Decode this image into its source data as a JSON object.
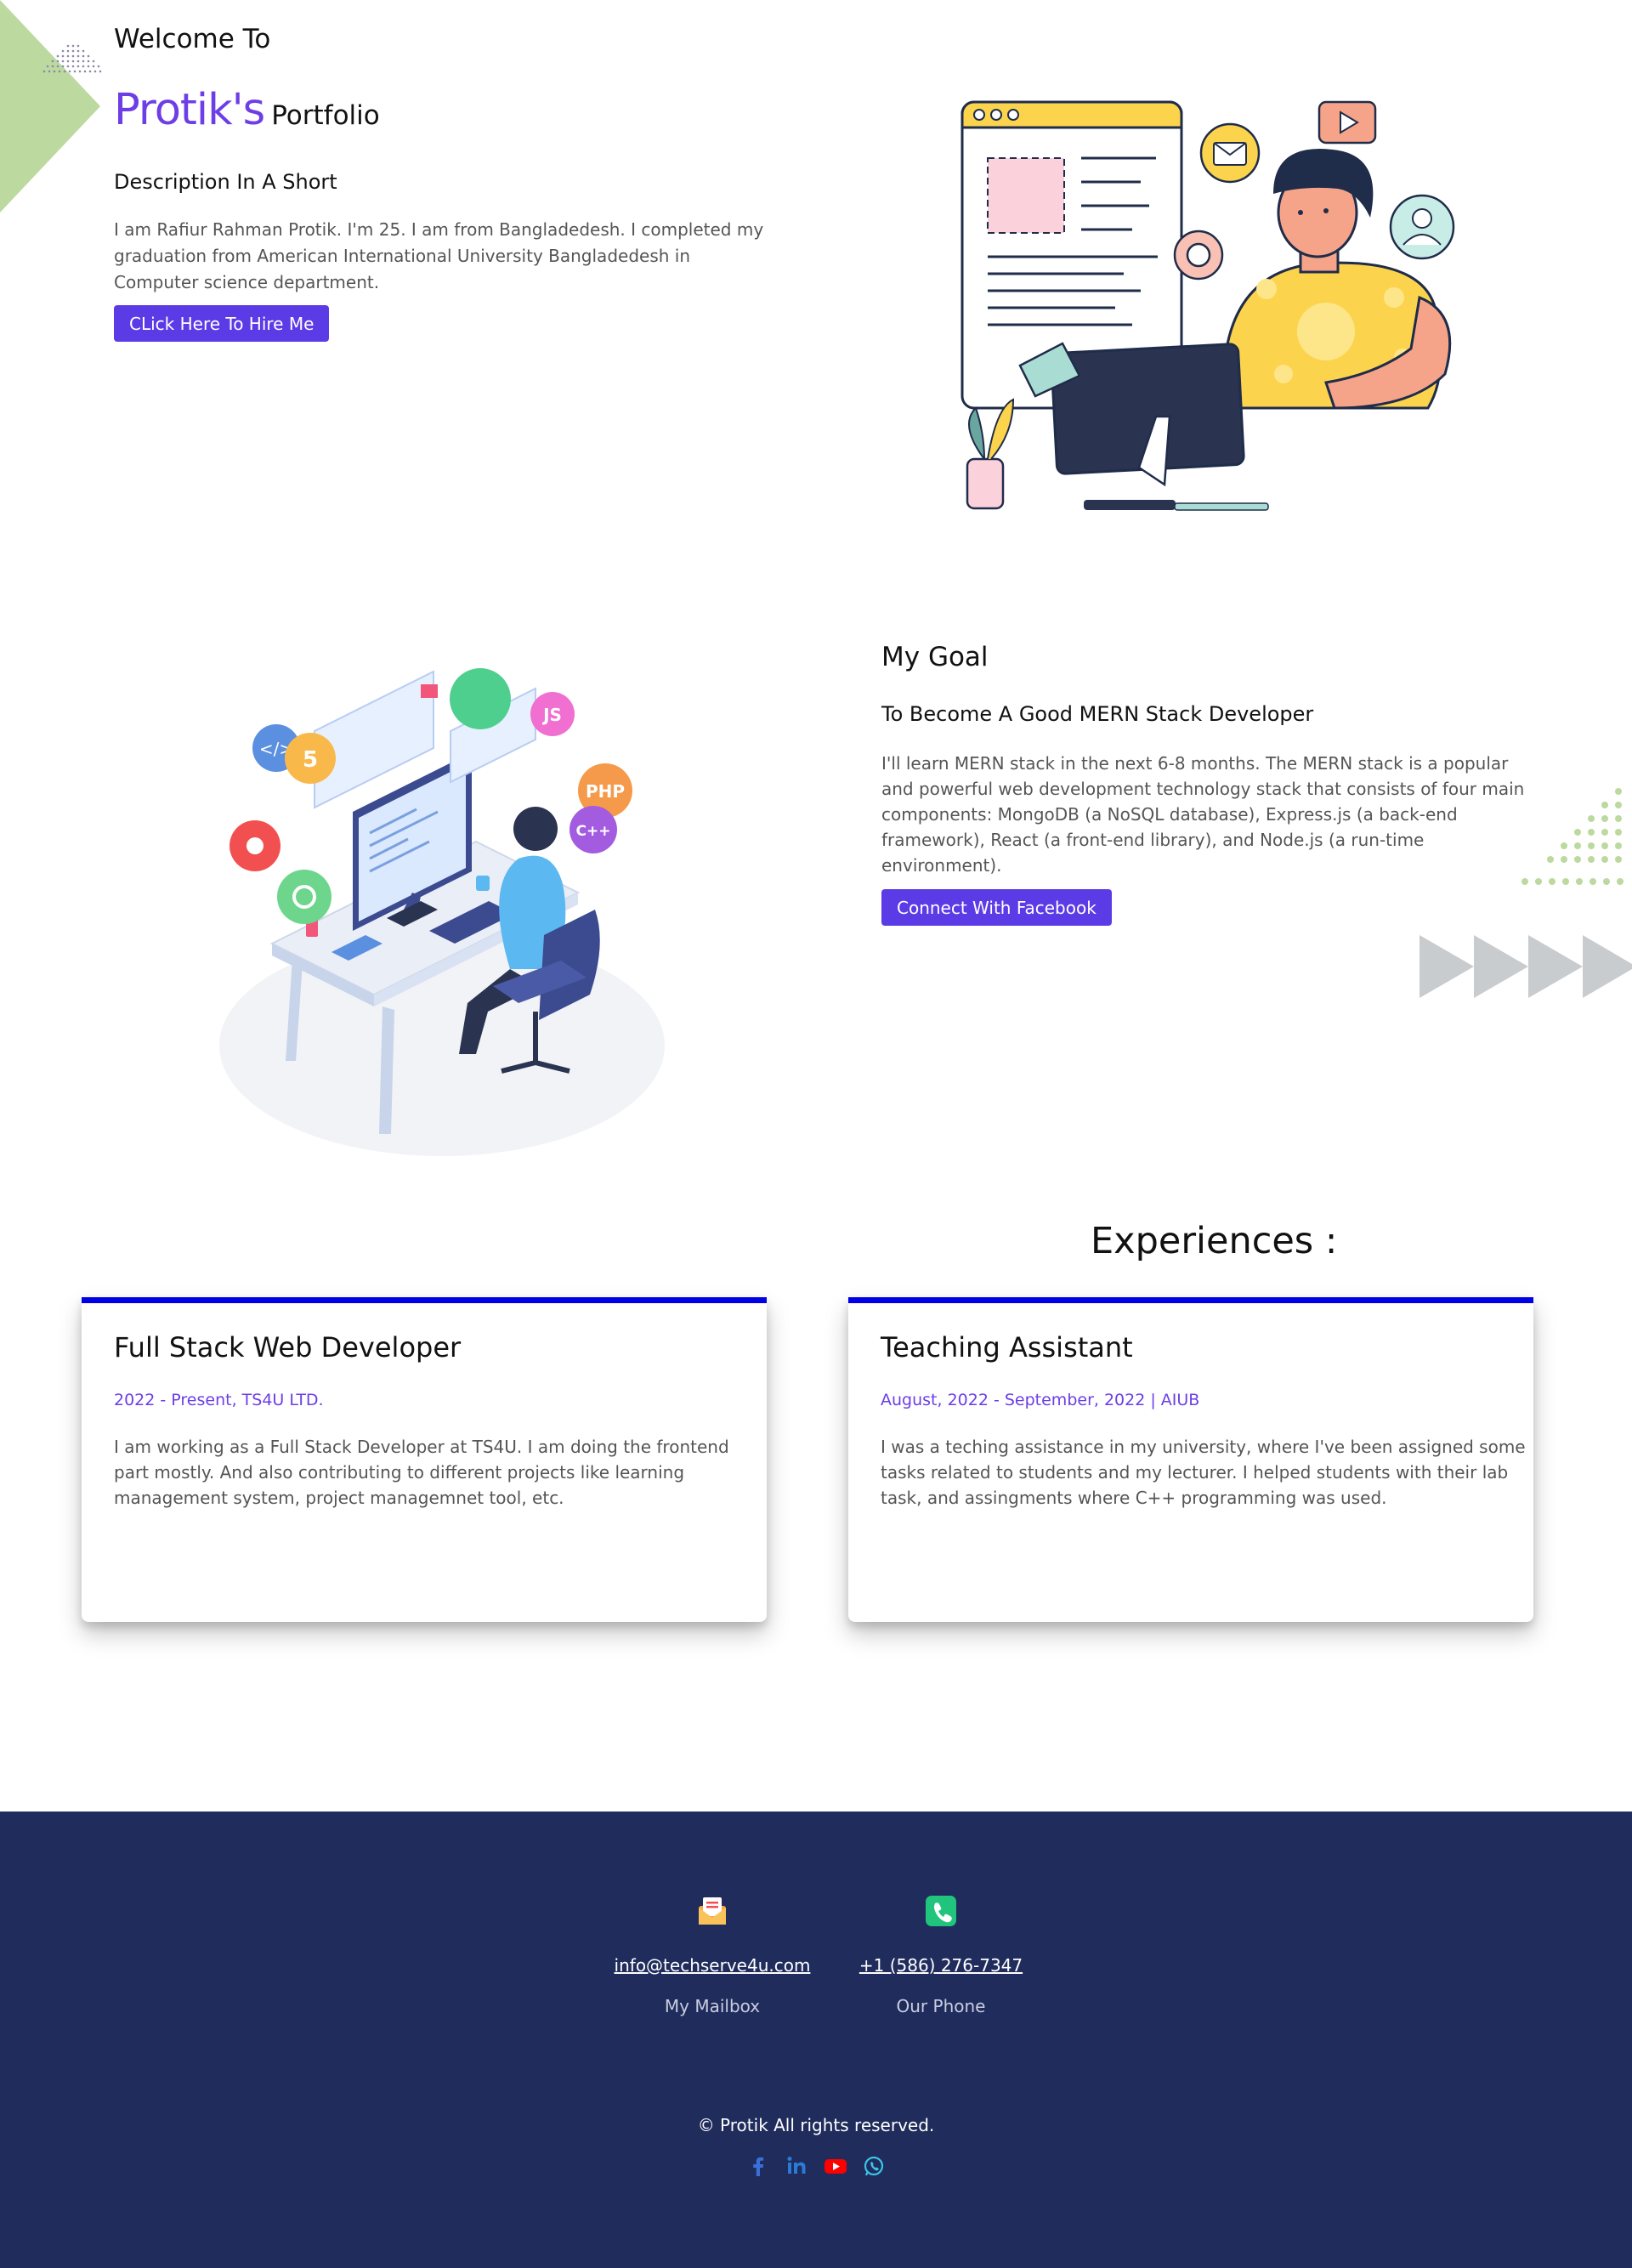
{
  "hero": {
    "welcome": "Welcome To",
    "brand_name": "Protik's",
    "brand_suffix": "Portfolio",
    "desc_title": "Description In A Short",
    "desc_text": "I am Rafiur Rahman Protik. I'm 25. I am from Bangladedesh. I completed my graduation from American International University Bangladedesh in Computer science department.",
    "hire_button": "CLick Here To Hire Me"
  },
  "goal": {
    "title": "My Goal",
    "subtitle": "To Become A Good MERN Stack Developer",
    "text": "I'll learn MERN stack in the next 6-8 months. The MERN stack is a popular and powerful web development technology stack that consists of four main components: MongoDB (a NoSQL database), Express.js (a back-end framework), React (a front-end library), and Node.js (a run-time environment).",
    "facebook_button": "Connect With Facebook",
    "illustration_badges": [
      "</>",
      "5",
      "JS",
      "PHP",
      "C++"
    ]
  },
  "experiences": {
    "heading": "Experiences :",
    "items": [
      {
        "title": "Full Stack Web Developer",
        "meta": "2022 - Present, TS4U LTD.",
        "text": "I am working as a Full Stack Developer at TS4U. I am doing the frontend part mostly. And also contributing to different projects like learning management system, project managemnet tool, etc."
      },
      {
        "title": "Teaching Assistant",
        "meta": "August, 2022 - September, 2022 | AIUB",
        "text": "I was a teching assistance in my university, where I've been assigned some tasks related to students and my lecturer. I helped students with their lab task, and assingments where C++ programming was used."
      }
    ]
  },
  "footer": {
    "mail": {
      "link": "info@techserve4u.com",
      "label": "My Mailbox",
      "icon": "mail-icon"
    },
    "phone": {
      "link": "+1 (586) 276-7347",
      "label": "Our Phone",
      "icon": "phone-icon"
    },
    "copyright": "© Protik All rights reserved.",
    "socials": [
      "facebook-icon",
      "linkedin-icon",
      "youtube-icon",
      "whatsapp-icon"
    ]
  },
  "colors": {
    "accent": "#6d3ee6",
    "button": "#5b3be6",
    "card_border": "#0000e6",
    "footer_bg": "#1f2c5c",
    "triangle": "#bcd99f"
  }
}
